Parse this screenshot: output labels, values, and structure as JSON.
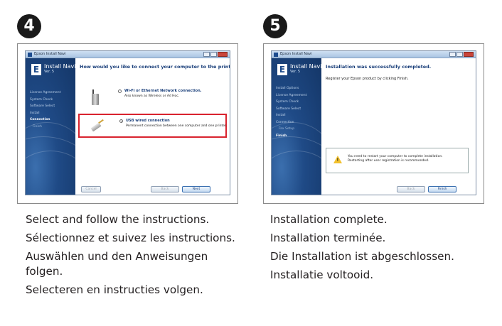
{
  "step4": {
    "badge": "4",
    "window": {
      "title": "Epson Install Navi",
      "app_name": "Install Navi",
      "version": "Ver. 5",
      "steps": [
        {
          "label": "License Agreement",
          "active": false,
          "sub": false
        },
        {
          "label": "System Check",
          "active": false,
          "sub": false
        },
        {
          "label": "Software Select",
          "active": false,
          "sub": false
        },
        {
          "label": "Install",
          "active": false,
          "sub": false
        },
        {
          "label": "Connection",
          "active": true,
          "sub": false
        },
        {
          "label": "Finish",
          "active": false,
          "sub": true
        }
      ],
      "heading": "How would you like to connect your computer to the printer?",
      "options": [
        {
          "title": "Wi-Fi or Ethernet Network connection.",
          "description": "Also known as Wireless or Ad Hoc.",
          "icon": "router-icon",
          "selected": false
        },
        {
          "title": "USB wired connection",
          "description": "Permanent connection between one computer and one printer.",
          "icon": "usb-cable-icon",
          "selected": true
        }
      ],
      "buttons": {
        "cancel": "Cancel",
        "back": "Back",
        "next": "Next"
      }
    },
    "captions": [
      "Select and follow the instructions.",
      "Sélectionnez et suivez les instructions.",
      "Auswählen und den Anweisungen folgen.",
      "Selecteren en instructies volgen."
    ]
  },
  "step5": {
    "badge": "5",
    "window": {
      "title": "Epson Install Navi",
      "app_name": "Install Navi",
      "version": "Ver. 5",
      "steps": [
        {
          "label": "Install Options",
          "active": false,
          "sub": false
        },
        {
          "label": "License Agreement",
          "active": false,
          "sub": false
        },
        {
          "label": "System Check",
          "active": false,
          "sub": false
        },
        {
          "label": "Software Select",
          "active": false,
          "sub": false
        },
        {
          "label": "Install",
          "active": false,
          "sub": false
        },
        {
          "label": "Connection",
          "active": false,
          "sub": false
        },
        {
          "label": "Fax Setup",
          "active": false,
          "sub": true
        },
        {
          "label": "Finish",
          "active": true,
          "sub": false
        }
      ],
      "heading": "Installation was successfully completed.",
      "subtext": "Register your Epson product by clicking Finish.",
      "message_line1": "You need to restart your computer to complete installation.",
      "message_line2": "Restarting after user registration is recommended.",
      "buttons": {
        "back": "Back",
        "finish": "Finish"
      }
    },
    "captions": [
      "Installation complete.",
      "Installation terminée.",
      "Die Installation ist abgeschlossen.",
      "Installatie voltooid."
    ]
  }
}
